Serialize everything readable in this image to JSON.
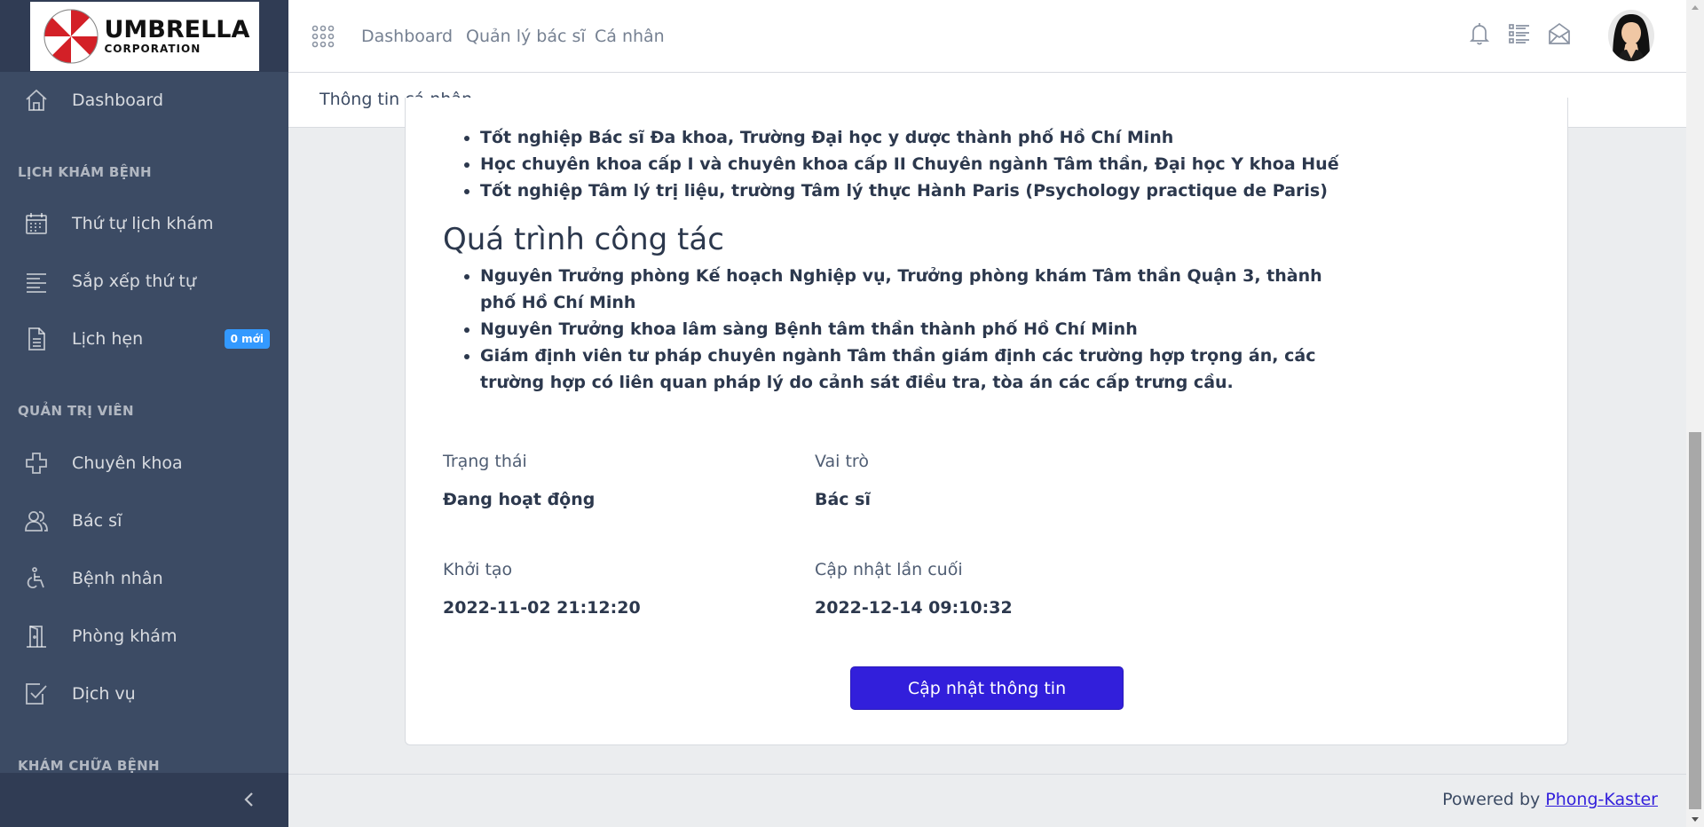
{
  "brand": {
    "logo_main": "UMBRELLA",
    "logo_sub": "CORPORATION"
  },
  "sidebar": {
    "items": [
      {
        "label": "Dashboard",
        "icon": "home-icon"
      },
      {
        "label": "Thứ tự lịch khám",
        "icon": "calendar-icon"
      },
      {
        "label": "Sắp xếp thứ tự",
        "icon": "align-left-icon"
      },
      {
        "label": "Lịch hẹn",
        "icon": "document-icon",
        "badge": "0 mới"
      },
      {
        "label": "Chuyên khoa",
        "icon": "medical-cross-icon"
      },
      {
        "label": "Bác sĩ",
        "icon": "people-icon"
      },
      {
        "label": "Bệnh nhân",
        "icon": "wheelchair-icon"
      },
      {
        "label": "Phòng khám",
        "icon": "door-icon"
      },
      {
        "label": "Dịch vụ",
        "icon": "task-check-icon"
      }
    ],
    "titles": [
      "LỊCH KHÁM BỆNH",
      "QUẢN TRỊ VIÊN",
      "KHÁM CHỮA BỆNH"
    ]
  },
  "header": {
    "nav": [
      "Dashboard",
      "Quản lý bác sĩ",
      "Cá nhân"
    ]
  },
  "breadcrumb": "Thông tin cá nhân",
  "education": [
    "Tốt nghiệp Bác sĩ Đa khoa, Trường Đại học y dược thành phố Hồ Chí Minh",
    "Học chuyên khoa cấp I và chuyên khoa cấp II Chuyên ngành Tâm thần, Đại học Y khoa Huế",
    "Tốt nghiệp Tâm lý trị liệu, trường Tâm lý thực Hành Paris (Psychology practique de Paris)"
  ],
  "work": {
    "title": "Quá trình công tác",
    "items": [
      "Nguyên Trưởng phòng Kế hoạch Nghiệp vụ, Trưởng phòng khám Tâm thần Quận 3, thành phố Hồ Chí Minh",
      "Nguyên Trưởng khoa lâm sàng Bệnh tâm thần thành phố Hồ Chí Minh",
      "Giám định viên tư pháp chuyên ngành Tâm thần giám định các trường hợp trọng án, các trường hợp có liên quan pháp lý do cảnh sát điều tra, tòa án các cấp trưng cầu."
    ]
  },
  "fields": {
    "status_label": "Trạng thái",
    "status_value": "Đang hoạt động",
    "role_label": "Vai trò",
    "role_value": "Bác sĩ",
    "created_label": "Khởi tạo",
    "created_value": "2022-11-02 21:12:20",
    "updated_label": "Cập nhật lần cuối",
    "updated_value": "2022-12-14 09:10:32"
  },
  "update_button": "Cập nhật thông tin",
  "footer": {
    "prefix": "Powered by",
    "link": "Phong-Kaster"
  },
  "colors": {
    "sidebar": "#3c4b64",
    "primary": "#321fdb",
    "badge": "#3399ff"
  }
}
